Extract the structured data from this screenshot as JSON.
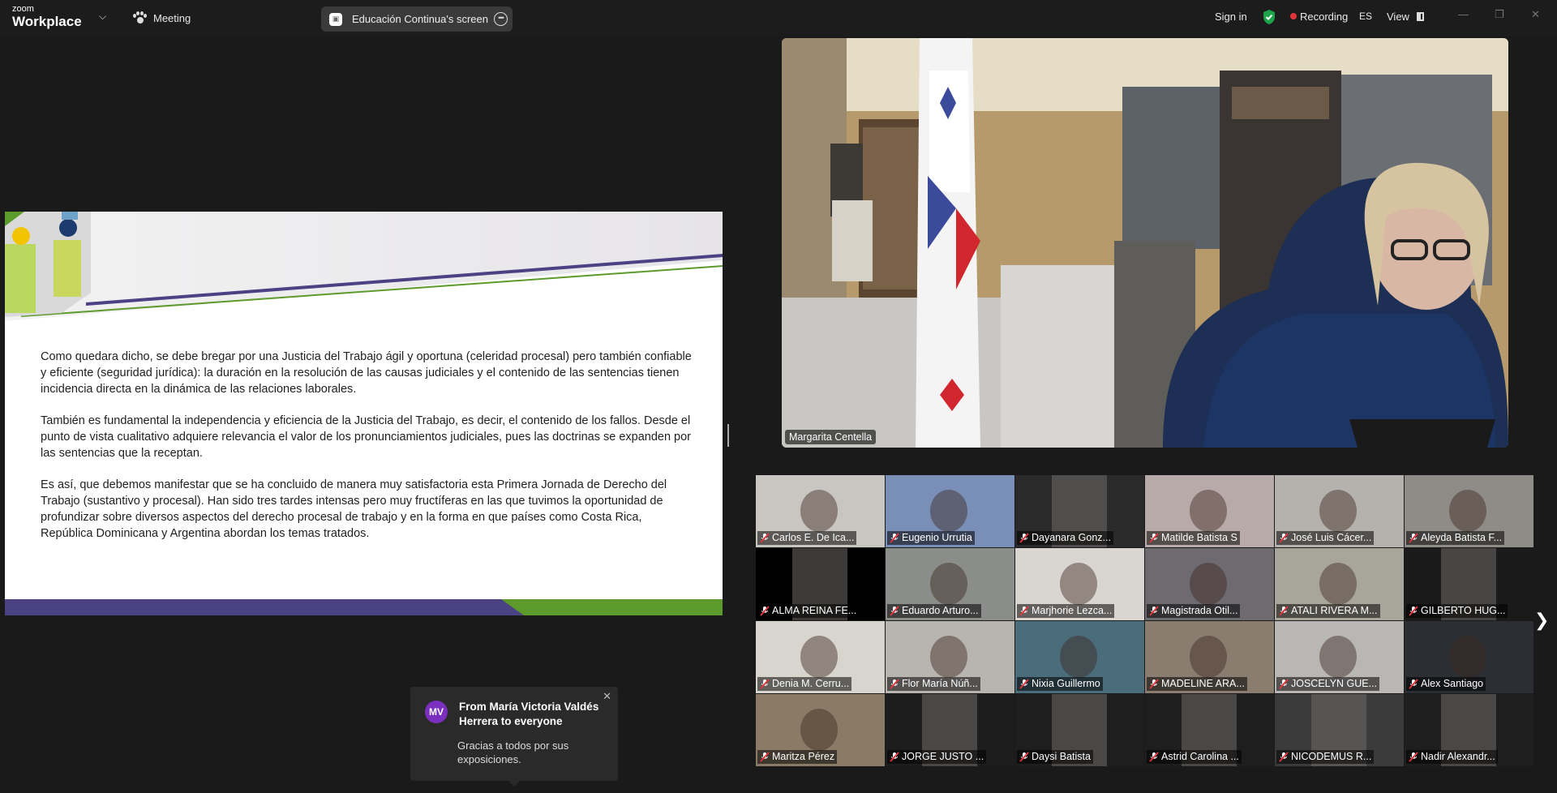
{
  "app": {
    "logo_line1": "zoom",
    "logo_line2": "Workplace",
    "meeting_label": "Meeting",
    "share_title": "Educación Continua's screen",
    "sign_in": "Sign in",
    "recording": "Recording",
    "language": "ES",
    "view": "View"
  },
  "colors": {
    "topbar_bg": "#1c1c1c",
    "background": "#1a1a1a",
    "recording_dot": "#e0353b",
    "shield_green": "#1fa34a",
    "slide_purple": "#4a4283",
    "slide_green": "#5c9a2b",
    "avatar_purple": "#7b2fbf",
    "mic_muted": "#e0353b"
  },
  "slide": {
    "paragraphs": [
      "Como quedara dicho, se debe bregar por una Justicia del Trabajo ágil y oportuna (celeridad procesal) pero también confiable y eficiente (seguridad jurídica): la duración en la resolución de las causas judiciales y el contenido de las sentencias tienen incidencia directa en la dinámica de las relaciones laborales.",
      "También es fundamental la independencia y eficiencia de la Justicia del Trabajo, es decir, el contenido de los fallos. Desde el punto de vista cualitativo adquiere relevancia el valor de los pronunciamientos judiciales, pues las doctrinas se expanden por las sentencias que la receptan.",
      "Es así, que debemos manifestar que se ha concluido de manera muy satisfactoria esta Primera Jornada de Derecho del Trabajo (sustantivo y procesal).  Han sido tres tardes intensas pero muy fructíferas en las que tuvimos la oportunidad de profundizar sobre diversos aspectos del derecho procesal de trabajo y en la forma en que países como Costa Rica, República Dominicana y Argentina abordan los temas tratados."
    ]
  },
  "speaker": {
    "name": "Margarita Centella"
  },
  "gallery": {
    "participants": [
      {
        "name": "Carlos E. De Ica...",
        "bg": "#c9c6c2"
      },
      {
        "name": "Eugenio Urrutia",
        "bg": "#7a8fb8"
      },
      {
        "name": "Dayanara Gonz...",
        "bg": "#2a2a2a"
      },
      {
        "name": "Matilde Batista S",
        "bg": "#b8aaa8"
      },
      {
        "name": "José Luis Cácer...",
        "bg": "#b5b2ad"
      },
      {
        "name": "Aleyda Batista F...",
        "bg": "#8f8c88"
      },
      {
        "name": "ALMA REINA FE...",
        "bg": "#000000"
      },
      {
        "name": "Eduardo Arturo...",
        "bg": "#8a8d8a"
      },
      {
        "name": "Marjhorie Lezca...",
        "bg": "#d9d6d2"
      },
      {
        "name": "Magistrada Otil...",
        "bg": "#6d6a70"
      },
      {
        "name": "ATALI RIVERA M...",
        "bg": "#a8a69a"
      },
      {
        "name": "GILBERTO HUG...",
        "bg": "#1a1a1a"
      },
      {
        "name": "Denia M. Cerru...",
        "bg": "#d8d4ce"
      },
      {
        "name": "Flor María Núñ...",
        "bg": "#b8b4b0"
      },
      {
        "name": "Nixia Guillermo",
        "bg": "#4b6c7a"
      },
      {
        "name": "MADELINE ARA...",
        "bg": "#8b7c70"
      },
      {
        "name": "JOSCELYN GUE...",
        "bg": "#b9b7b4"
      },
      {
        "name": "Alex Santiago",
        "bg": "#2b2e33"
      },
      {
        "name": "Maritza Pérez ",
        "bg": "#8a7a66"
      },
      {
        "name": "JORGE JUSTO ...",
        "bg": "#1d1d1d"
      },
      {
        "name": "Daysi Batista",
        "bg": "#1e1e1e"
      },
      {
        "name": "Astrid Carolina ...",
        "bg": "#1e1e1e"
      },
      {
        "name": "NICODEMUS R...",
        "bg": "#3b3b3b"
      },
      {
        "name": "Nadir Alexandr...",
        "bg": "#1e1e1e"
      }
    ]
  },
  "chat": {
    "avatar": "MV",
    "title": "From María Victoria Valdés Herrera to everyone",
    "message": "Gracias a todos por sus exposiciones."
  },
  "icons": {
    "dropdown": "chevron-down-icon",
    "meeting": "paw-icon",
    "more": "more-options-icon",
    "shield": "shield-check-icon",
    "mic": "mic-muted-icon",
    "next": "chevron-right-icon",
    "close": "close-icon"
  }
}
